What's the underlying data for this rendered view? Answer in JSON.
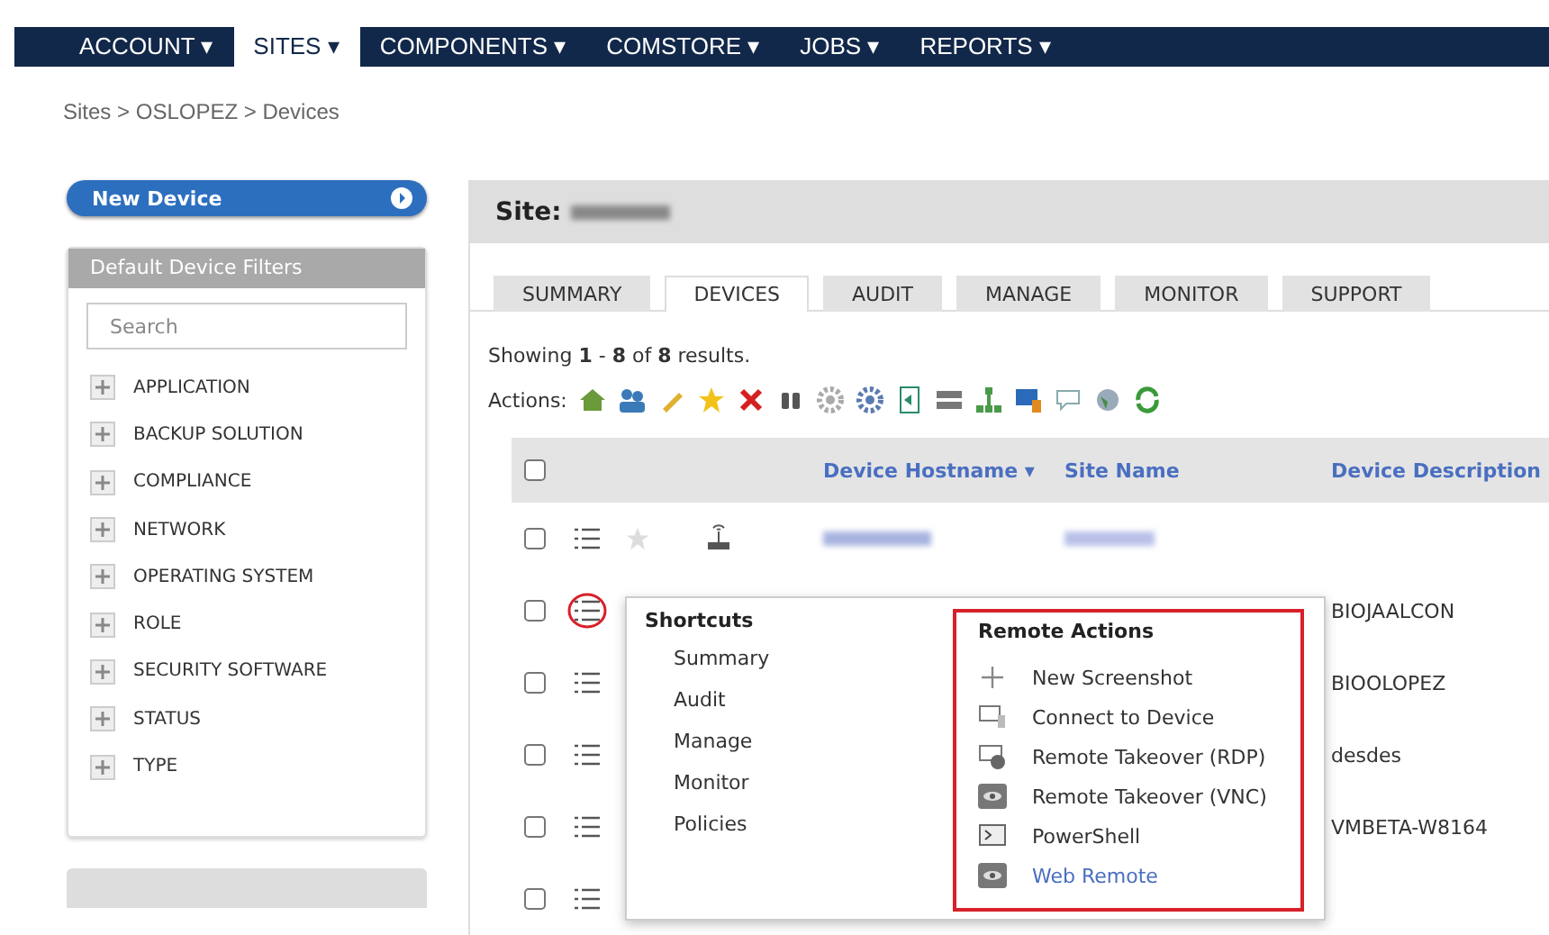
{
  "nav": {
    "items": [
      {
        "label": "ACCOUNT ▾",
        "selected": false
      },
      {
        "label": "SITES ▾",
        "selected": true
      },
      {
        "label": "COMPONENTS ▾",
        "selected": false
      },
      {
        "label": "COMSTORE ▾",
        "selected": false
      },
      {
        "label": "JOBS ▾",
        "selected": false
      },
      {
        "label": "REPORTS ▾",
        "selected": false
      }
    ]
  },
  "breadcrumb": "Sites > OSLOPEZ > Devices",
  "sidebar": {
    "new_device_button": "New Device",
    "filter_panel": {
      "title": "Default Device Filters",
      "search": {
        "placeholder": "Search"
      },
      "items": [
        "APPLICATION",
        "BACKUP SOLUTION",
        "COMPLIANCE",
        "NETWORK",
        "OPERATING SYSTEM",
        "ROLE",
        "SECURITY SOFTWARE",
        "STATUS",
        "TYPE"
      ]
    }
  },
  "main": {
    "site_label": "Site:",
    "tabs": [
      {
        "label": "SUMMARY",
        "selected": false
      },
      {
        "label": "DEVICES",
        "selected": true
      },
      {
        "label": "AUDIT",
        "selected": false
      },
      {
        "label": "MANAGE",
        "selected": false
      },
      {
        "label": "MONITOR",
        "selected": false
      },
      {
        "label": "SUPPORT",
        "selected": false
      }
    ],
    "showing": "Showing **1** - **8** of **8** results.",
    "actions_label": "Actions:",
    "table": {
      "header_checked": false,
      "columns": [
        {
          "label": "Device Hostname",
          "sort": "▾"
        },
        {
          "label": "Site Name"
        },
        {
          "label": "Device Description"
        }
      ],
      "rows": [
        {
          "checked": false,
          "menu_open": false,
          "description": ""
        },
        {
          "checked": false,
          "menu_open": true,
          "description": "BIOJAALCON"
        },
        {
          "checked": false,
          "menu_open": false,
          "description": "BIOOLOPEZ"
        },
        {
          "checked": false,
          "menu_open": false,
          "description": "desdes"
        },
        {
          "checked": false,
          "menu_open": false,
          "description": "VMBETA-W8164"
        },
        {
          "checked": false,
          "menu_open": false,
          "description": ""
        }
      ]
    },
    "popup": {
      "shortcuts": {
        "title": "Shortcuts",
        "items": [
          "Summary",
          "Audit",
          "Manage",
          "Monitor",
          "Policies"
        ]
      },
      "remote_actions": {
        "title": "Remote Actions",
        "highlighted": true,
        "items": [
          {
            "label": "New Screenshot",
            "kind": "screenshot",
            "hovered": false
          },
          {
            "label": "Connect to Device",
            "kind": "connect",
            "hovered": false
          },
          {
            "label": "Remote Takeover (RDP)",
            "kind": "rdp",
            "hovered": false
          },
          {
            "label": "Remote Takeover (VNC)",
            "kind": "vnc",
            "hovered": false
          },
          {
            "label": "PowerShell",
            "kind": "shell",
            "hovered": false
          },
          {
            "label": "Web Remote",
            "kind": "web",
            "hovered": true
          }
        ]
      }
    }
  }
}
